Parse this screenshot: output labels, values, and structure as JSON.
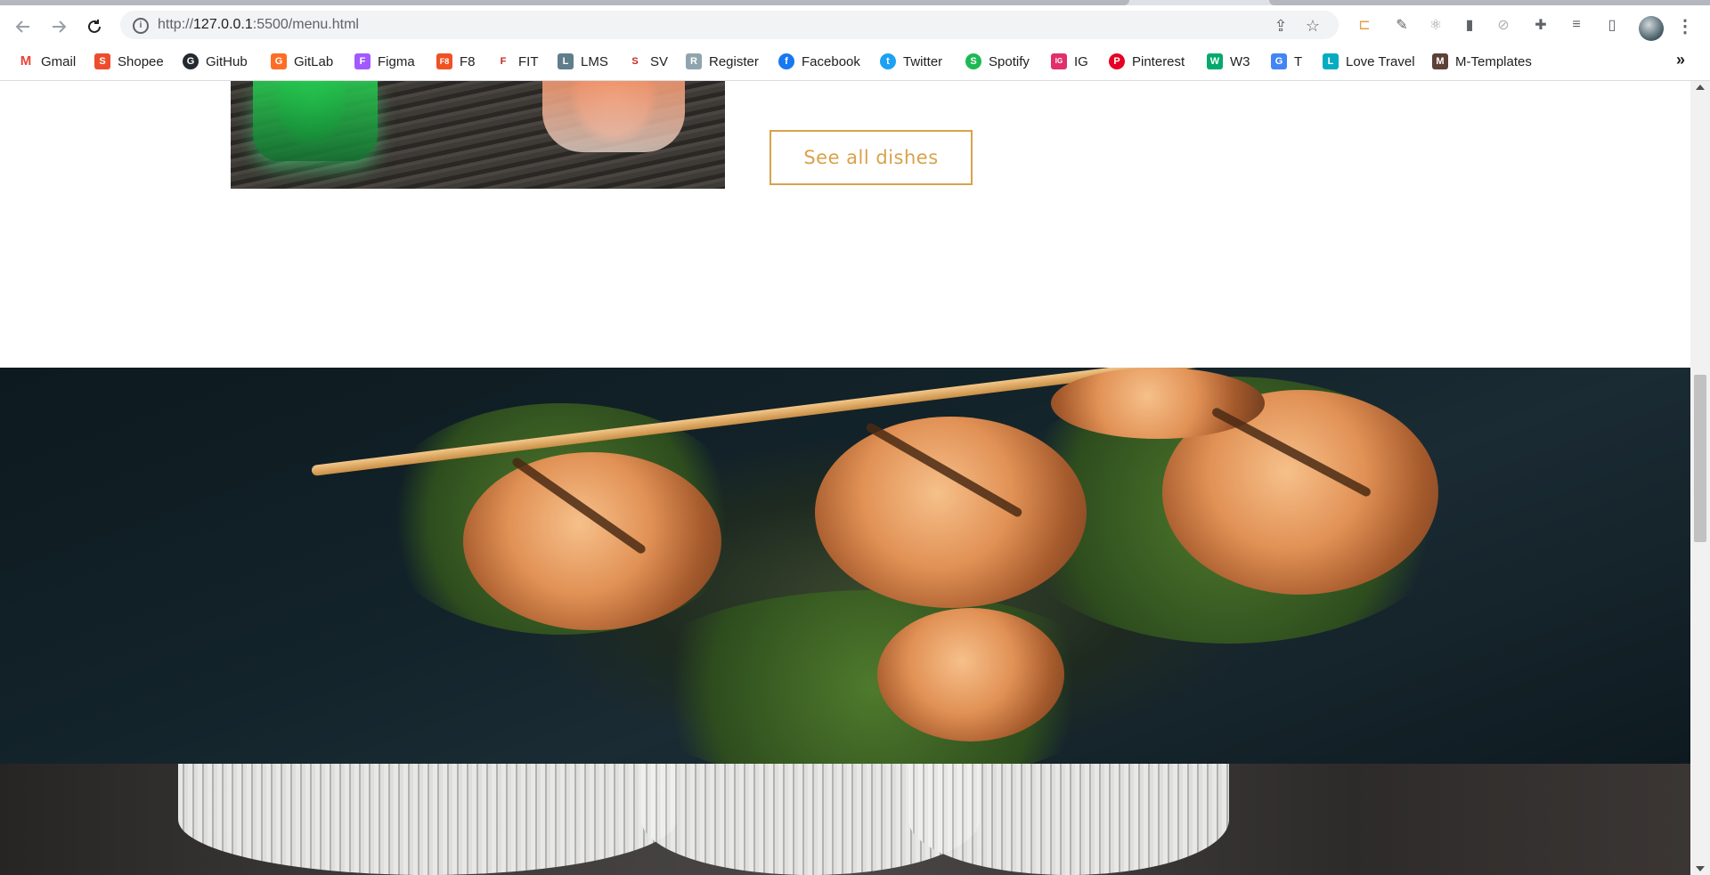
{
  "browser": {
    "url_prefix": "http://",
    "url_host": "127.0.0.1",
    "url_path": ":5500/menu.html",
    "back_icon": "arrow-left-icon",
    "forward_icon": "arrow-right-icon",
    "reload_icon": "reload-icon",
    "site_info_icon": "info-icon",
    "share_icon": "share-icon",
    "bookmark_icon": "star-icon",
    "extensions_icon": "puzzle-icon",
    "menu_icon": "kebab-icon"
  },
  "bookmarks": [
    {
      "label": "Gmail",
      "color": "#ea4335",
      "glyph": "M"
    },
    {
      "label": "Shopee",
      "color": "#ee4d2d",
      "glyph": "S"
    },
    {
      "label": "GitHub",
      "color": "#24292f",
      "glyph": "G"
    },
    {
      "label": "GitLab",
      "color": "#fc6d26",
      "glyph": "G"
    },
    {
      "label": "Figma",
      "color": "#a259ff",
      "glyph": "F"
    },
    {
      "label": "F8",
      "color": "#f05123",
      "glyph": "F8"
    },
    {
      "label": "FIT",
      "color": "#c62828",
      "glyph": "F"
    },
    {
      "label": "LMS",
      "color": "#607d8b",
      "glyph": "L"
    },
    {
      "label": "SV",
      "color": "#c62828",
      "glyph": "S"
    },
    {
      "label": "Register",
      "color": "#90a4ae",
      "glyph": "R"
    },
    {
      "label": "Facebook",
      "color": "#1877f2",
      "glyph": "f"
    },
    {
      "label": "Twitter",
      "color": "#1da1f2",
      "glyph": "t"
    },
    {
      "label": "Spotify",
      "color": "#1db954",
      "glyph": "S"
    },
    {
      "label": "IG",
      "color": "#e1306c",
      "glyph": "IG"
    },
    {
      "label": "Pinterest",
      "color": "#e60023",
      "glyph": "P"
    },
    {
      "label": "W3",
      "color": "#04aa6d",
      "glyph": "W"
    },
    {
      "label": "T",
      "color": "#4285f4",
      "glyph": "G"
    },
    {
      "label": "Love Travel",
      "color": "#00acc1",
      "glyph": "L"
    },
    {
      "label": "M-Templates",
      "color": "#5d4037",
      "glyph": "M"
    }
  ],
  "bookmarks_more": "»",
  "page": {
    "see_all_label": "See all dishes",
    "accent_color": "#d9a24b"
  }
}
